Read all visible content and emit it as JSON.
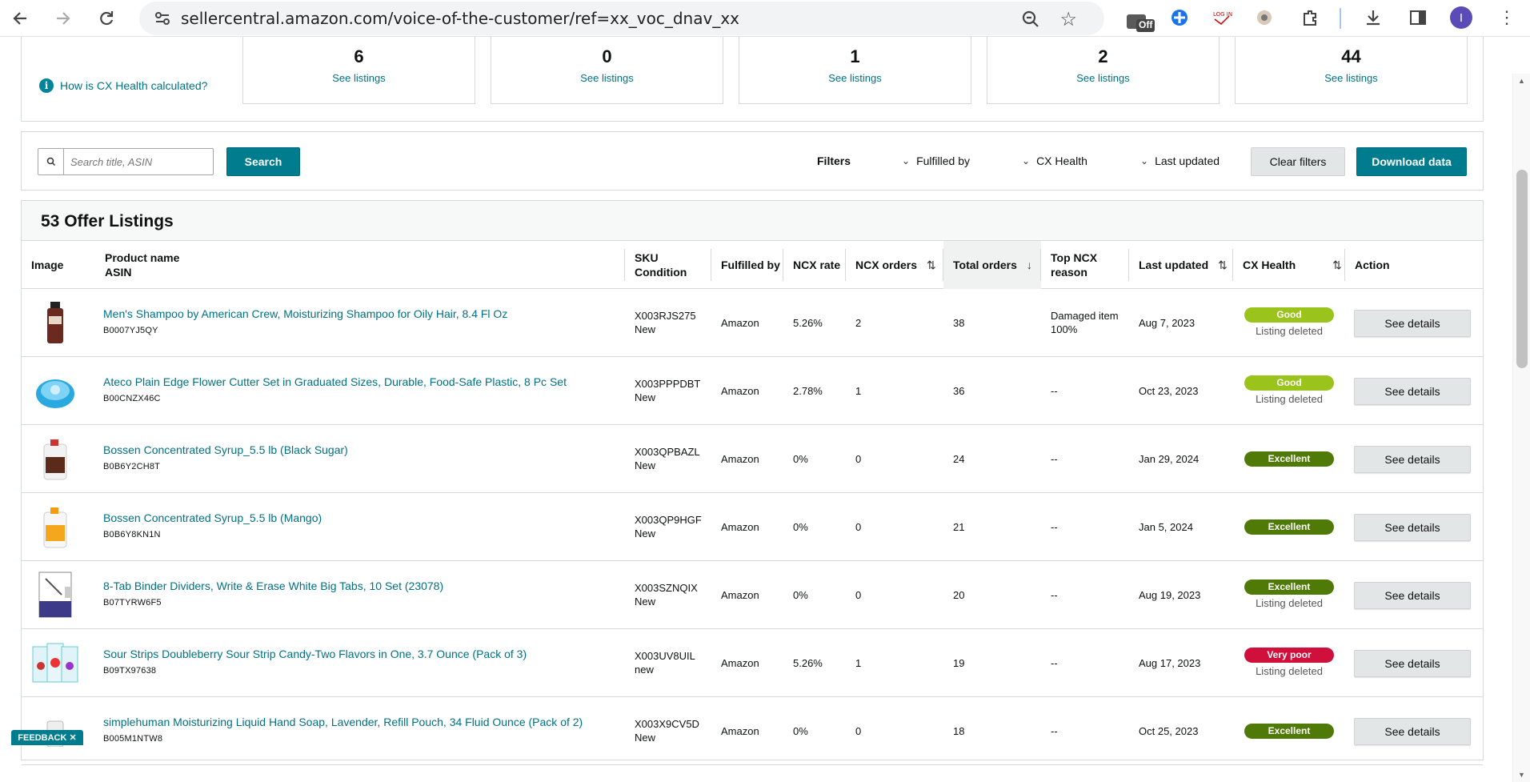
{
  "browser": {
    "url": "sellercentral.amazon.com/voice-of-the-customer/ref=xx_voc_dnav_xx",
    "extension_badge": "Off",
    "profile_initial": "I"
  },
  "summary": {
    "help_link": "How is CX Health calculated?",
    "cards": [
      {
        "count": "6",
        "link": "See listings"
      },
      {
        "count": "0",
        "link": "See listings"
      },
      {
        "count": "1",
        "link": "See listings"
      },
      {
        "count": "2",
        "link": "See listings"
      },
      {
        "count": "44",
        "link": "See listings"
      }
    ]
  },
  "filter_bar": {
    "search_placeholder": "Search title, ASIN",
    "search_button": "Search",
    "filters_label": "Filters",
    "dropdowns": [
      "Fulfilled by",
      "CX Health",
      "Last updated"
    ],
    "clear_filters": "Clear filters",
    "download_data": "Download data"
  },
  "table": {
    "title": "53 Offer Listings",
    "headers": {
      "image": "Image",
      "product_name": "Product name",
      "asin": "ASIN",
      "sku": "SKU",
      "condition": "Condition",
      "fulfilled_by": "Fulfilled by",
      "ncx_rate": "NCX rate",
      "ncx_orders": "NCX orders",
      "total_orders": "Total orders",
      "top_ncx_1": "Top NCX",
      "top_ncx_2": "reason",
      "last_updated": "Last updated",
      "cx_health": "CX Health",
      "action": "Action"
    },
    "rows": [
      {
        "name": "Men's Shampoo by American Crew, Moisturizing Shampoo for Oily Hair, 8.4 Fl Oz",
        "asin": "B0007YJ5QY",
        "sku": "X003RJS275",
        "condition": "New",
        "fulfilled": "Amazon",
        "ncx_rate": "5.26%",
        "ncx_orders": "2",
        "total_orders": "38",
        "reason_1": "Damaged item",
        "reason_2": "100%",
        "updated": "Aug 7, 2023",
        "health": "Good",
        "health_color": "#9ac31c",
        "health_sub": "Listing deleted",
        "action": "See details",
        "thumb": "bottle"
      },
      {
        "name": "Ateco Plain Edge Flower Cutter Set in Graduated Sizes, Durable, Food-Safe Plastic, 8 Pc Set",
        "asin": "B00CNZX46C",
        "sku": "X003PPPDBT",
        "condition": "New",
        "fulfilled": "Amazon",
        "ncx_rate": "2.78%",
        "ncx_orders": "1",
        "total_orders": "36",
        "reason_1": "--",
        "reason_2": "",
        "updated": "Oct 23, 2023",
        "health": "Good",
        "health_color": "#9ac31c",
        "health_sub": "Listing deleted",
        "action": "See details",
        "thumb": "cutter"
      },
      {
        "name": "Bossen Concentrated Syrup_5.5 lb (Black Sugar)",
        "asin": "B0B6Y2CH8T",
        "sku": "X003QPBAZL",
        "condition": "New",
        "fulfilled": "Amazon",
        "ncx_rate": "0%",
        "ncx_orders": "0",
        "total_orders": "24",
        "reason_1": "--",
        "reason_2": "",
        "updated": "Jan 29, 2024",
        "health": "Excellent",
        "health_color": "#507a07",
        "health_sub": "",
        "action": "See details",
        "thumb": "jug-dark"
      },
      {
        "name": "Bossen Concentrated Syrup_5.5 lb (Mango)",
        "asin": "B0B6Y8KN1N",
        "sku": "X003QP9HGF",
        "condition": "New",
        "fulfilled": "Amazon",
        "ncx_rate": "0%",
        "ncx_orders": "0",
        "total_orders": "21",
        "reason_1": "--",
        "reason_2": "",
        "updated": "Jan 5, 2024",
        "health": "Excellent",
        "health_color": "#507a07",
        "health_sub": "",
        "action": "See details",
        "thumb": "jug-mango"
      },
      {
        "name": "8-Tab Binder Dividers, Write & Erase White Big Tabs, 10 Set (23078)",
        "asin": "B07TYRW6F5",
        "sku": "X003SZNQIX",
        "condition": "New",
        "fulfilled": "Amazon",
        "ncx_rate": "0%",
        "ncx_orders": "0",
        "total_orders": "20",
        "reason_1": "--",
        "reason_2": "",
        "updated": "Aug 19, 2023",
        "health": "Excellent",
        "health_color": "#507a07",
        "health_sub": "Listing deleted",
        "action": "See details",
        "thumb": "binder"
      },
      {
        "name": "Sour Strips Doubleberry Sour Strip Candy-Two Flavors in One, 3.7 Ounce (Pack of 3)",
        "asin": "B09TX97638",
        "sku": "X003UV8UIL",
        "condition": "new",
        "fulfilled": "Amazon",
        "ncx_rate": "5.26%",
        "ncx_orders": "1",
        "total_orders": "19",
        "reason_1": "--",
        "reason_2": "",
        "updated": "Aug 17, 2023",
        "health": "Very poor",
        "health_color": "#d0103a",
        "health_sub": "Listing deleted",
        "action": "See details",
        "thumb": "candy"
      },
      {
        "name": "simplehuman Moisturizing Liquid Hand Soap, Lavender, Refill Pouch, 34 Fluid Ounce (Pack of 2)",
        "asin": "B005M1NTW8",
        "sku": "X003X9CV5D",
        "condition": "New",
        "fulfilled": "Amazon",
        "ncx_rate": "0%",
        "ncx_orders": "0",
        "total_orders": "18",
        "reason_1": "--",
        "reason_2": "",
        "updated": "Oct 25, 2023",
        "health": "Excellent",
        "health_color": "#507a07",
        "health_sub": "",
        "action": "See details",
        "thumb": "pouch"
      }
    ]
  },
  "feedback": "FEEDBACK ✕"
}
